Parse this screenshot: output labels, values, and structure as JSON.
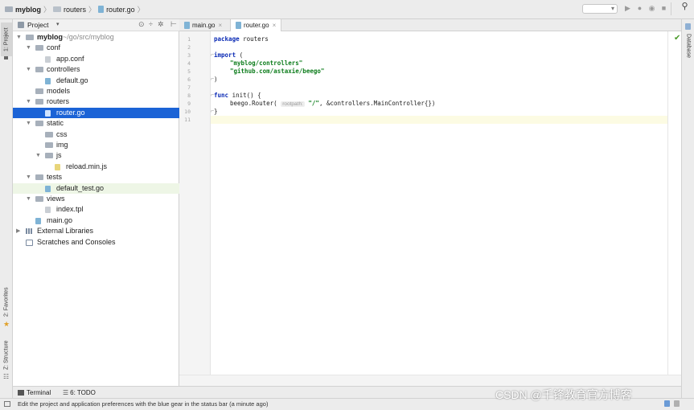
{
  "breadcrumb": {
    "project": "myblog",
    "folder": "routers",
    "file": "router.go"
  },
  "left_strip": {
    "project_tab": "1: Project",
    "favorites_tab": "2: Favorites",
    "structure_tab": "Z: Structure"
  },
  "right_strip": {
    "database_tab": "Database"
  },
  "project_panel": {
    "title": "Project",
    "tree": [
      {
        "label": "myblog",
        "hint": "~/go/src/myblog",
        "type": "folder",
        "depth": 0,
        "expanded": true
      },
      {
        "label": "conf",
        "type": "folder",
        "depth": 1,
        "expanded": true
      },
      {
        "label": "app.conf",
        "type": "file",
        "depth": 2
      },
      {
        "label": "controllers",
        "type": "folder",
        "depth": 1,
        "expanded": true
      },
      {
        "label": "default.go",
        "type": "gofile",
        "depth": 2
      },
      {
        "label": "models",
        "type": "folder",
        "depth": 1,
        "expanded": false
      },
      {
        "label": "routers",
        "type": "folder",
        "depth": 1,
        "expanded": true
      },
      {
        "label": "router.go",
        "type": "gofile",
        "depth": 2,
        "selected": true
      },
      {
        "label": "static",
        "type": "folder",
        "depth": 1,
        "expanded": true
      },
      {
        "label": "css",
        "type": "folder",
        "depth": 2,
        "expanded": false
      },
      {
        "label": "img",
        "type": "folder",
        "depth": 2,
        "expanded": false
      },
      {
        "label": "js",
        "type": "folder",
        "depth": 2,
        "expanded": true
      },
      {
        "label": "reload.min.js",
        "type": "jsfile",
        "depth": 3
      },
      {
        "label": "tests",
        "type": "folder",
        "depth": 1,
        "expanded": true
      },
      {
        "label": "default_test.go",
        "type": "gofile",
        "depth": 2,
        "highlighted": true
      },
      {
        "label": "views",
        "type": "folder",
        "depth": 1,
        "expanded": true
      },
      {
        "label": "index.tpl",
        "type": "file",
        "depth": 2
      },
      {
        "label": "main.go",
        "type": "gofile",
        "depth": 1
      },
      {
        "label": "External Libraries",
        "type": "library",
        "depth": 0,
        "expanded": false
      },
      {
        "label": "Scratches and Consoles",
        "type": "scratch",
        "depth": 0
      }
    ]
  },
  "editor": {
    "tabs": [
      {
        "label": "main.go",
        "active": false
      },
      {
        "label": "router.go",
        "active": true
      }
    ],
    "line_numbers": [
      "1",
      "2",
      "3",
      "4",
      "5",
      "6",
      "7",
      "8",
      "9",
      "10",
      "11"
    ],
    "code": {
      "l1_kw": "package",
      "l1_rest": " routers",
      "l3_kw": "import",
      "l3_rest": " (",
      "l4_str": "\"myblog/controllers\"",
      "l5_str": "\"github.com/astaxie/beego\"",
      "l6": ")",
      "l8_kw": "func",
      "l8_rest": " init() {",
      "l9_pre": "beego.Router(",
      "l9_hint": "rootpath:",
      "l9_str": "\"/\"",
      "l9_post": ", &controllers.MainController{})",
      "l10": "}"
    }
  },
  "tool_windows": {
    "terminal": "Terminal",
    "todo": "6: TODO"
  },
  "status_bar": {
    "message": "Edit the project and application preferences with the blue gear in the status bar (a minute ago)"
  },
  "watermark": "CSDN @千锋教育官方博客"
}
